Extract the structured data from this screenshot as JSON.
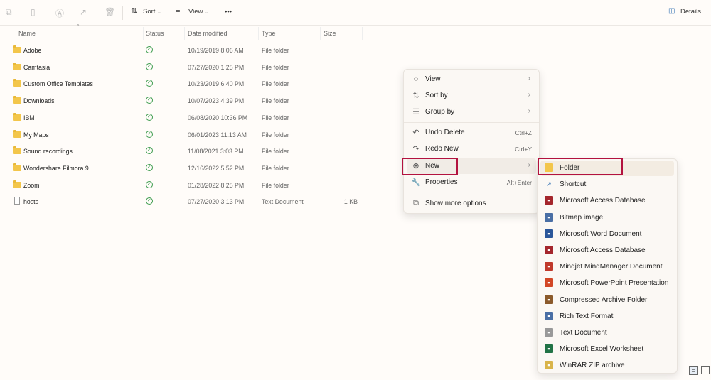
{
  "toolbar": {
    "sort": "Sort",
    "view": "View",
    "more": "•••",
    "details": "Details"
  },
  "columns": {
    "name": "Name",
    "status": "Status",
    "date": "Date modified",
    "type": "Type",
    "size": "Size"
  },
  "files": [
    {
      "name": "Adobe",
      "date": "10/19/2019 8:06 AM",
      "type": "File folder",
      "size": "",
      "kind": "folder"
    },
    {
      "name": "Camtasia",
      "date": "07/27/2020 1:25 PM",
      "type": "File folder",
      "size": "",
      "kind": "folder"
    },
    {
      "name": "Custom Office Templates",
      "date": "10/23/2019 6:40 PM",
      "type": "File folder",
      "size": "",
      "kind": "folder"
    },
    {
      "name": "Downloads",
      "date": "10/07/2023 4:39 PM",
      "type": "File folder",
      "size": "",
      "kind": "folder"
    },
    {
      "name": "IBM",
      "date": "06/08/2020 10:36 PM",
      "type": "File folder",
      "size": "",
      "kind": "folder"
    },
    {
      "name": "My Maps",
      "date": "06/01/2023 11:13 AM",
      "type": "File folder",
      "size": "",
      "kind": "folder"
    },
    {
      "name": "Sound recordings",
      "date": "11/08/2021 3:03 PM",
      "type": "File folder",
      "size": "",
      "kind": "folder"
    },
    {
      "name": "Wondershare Filmora 9",
      "date": "12/16/2022 5:52 PM",
      "type": "File folder",
      "size": "",
      "kind": "folder"
    },
    {
      "name": "Zoom",
      "date": "01/28/2022 8:25 PM",
      "type": "File folder",
      "size": "",
      "kind": "folder"
    },
    {
      "name": "hosts",
      "date": "07/27/2020 3:13 PM",
      "type": "Text Document",
      "size": "1 KB",
      "kind": "file"
    }
  ],
  "context_menu": [
    {
      "label": "View",
      "icon": "grid-icon",
      "submenu": true
    },
    {
      "label": "Sort by",
      "icon": "sort-icon",
      "submenu": true
    },
    {
      "label": "Group by",
      "icon": "group-icon",
      "submenu": true
    },
    {
      "label": "Undo Delete",
      "icon": "undo-icon",
      "shortcut": "Ctrl+Z"
    },
    {
      "label": "Redo New",
      "icon": "redo-icon",
      "shortcut": "Ctrl+Y"
    },
    {
      "label": "New",
      "icon": "plus-circle-icon",
      "submenu": true
    },
    {
      "label": "Properties",
      "icon": "wrench-icon",
      "shortcut": "Alt+Enter"
    },
    {
      "label": "Show more options",
      "icon": "expand-icon"
    }
  ],
  "submenu": [
    {
      "label": "Folder",
      "color": "#f3c64b"
    },
    {
      "label": "Shortcut",
      "color": "#2b6cb0"
    },
    {
      "label": "Microsoft Access Database",
      "color": "#a4262c"
    },
    {
      "label": "Bitmap image",
      "color": "#4a6fa5"
    },
    {
      "label": "Microsoft Word Document",
      "color": "#2b579a"
    },
    {
      "label": "Microsoft Access Database",
      "color": "#a4262c"
    },
    {
      "label": "Mindjet MindManager Document",
      "color": "#c0392b"
    },
    {
      "label": "Microsoft PowerPoint Presentation",
      "color": "#d24726"
    },
    {
      "label": "Compressed Archive Folder",
      "color": "#8b5a2b"
    },
    {
      "label": "Rich Text Format",
      "color": "#4a6fa5"
    },
    {
      "label": "Text Document",
      "color": "#999999"
    },
    {
      "label": "Microsoft Excel Worksheet",
      "color": "#217346"
    },
    {
      "label": "WinRAR ZIP archive",
      "color": "#d9b44a"
    }
  ],
  "highlight_color": "#b3123f"
}
